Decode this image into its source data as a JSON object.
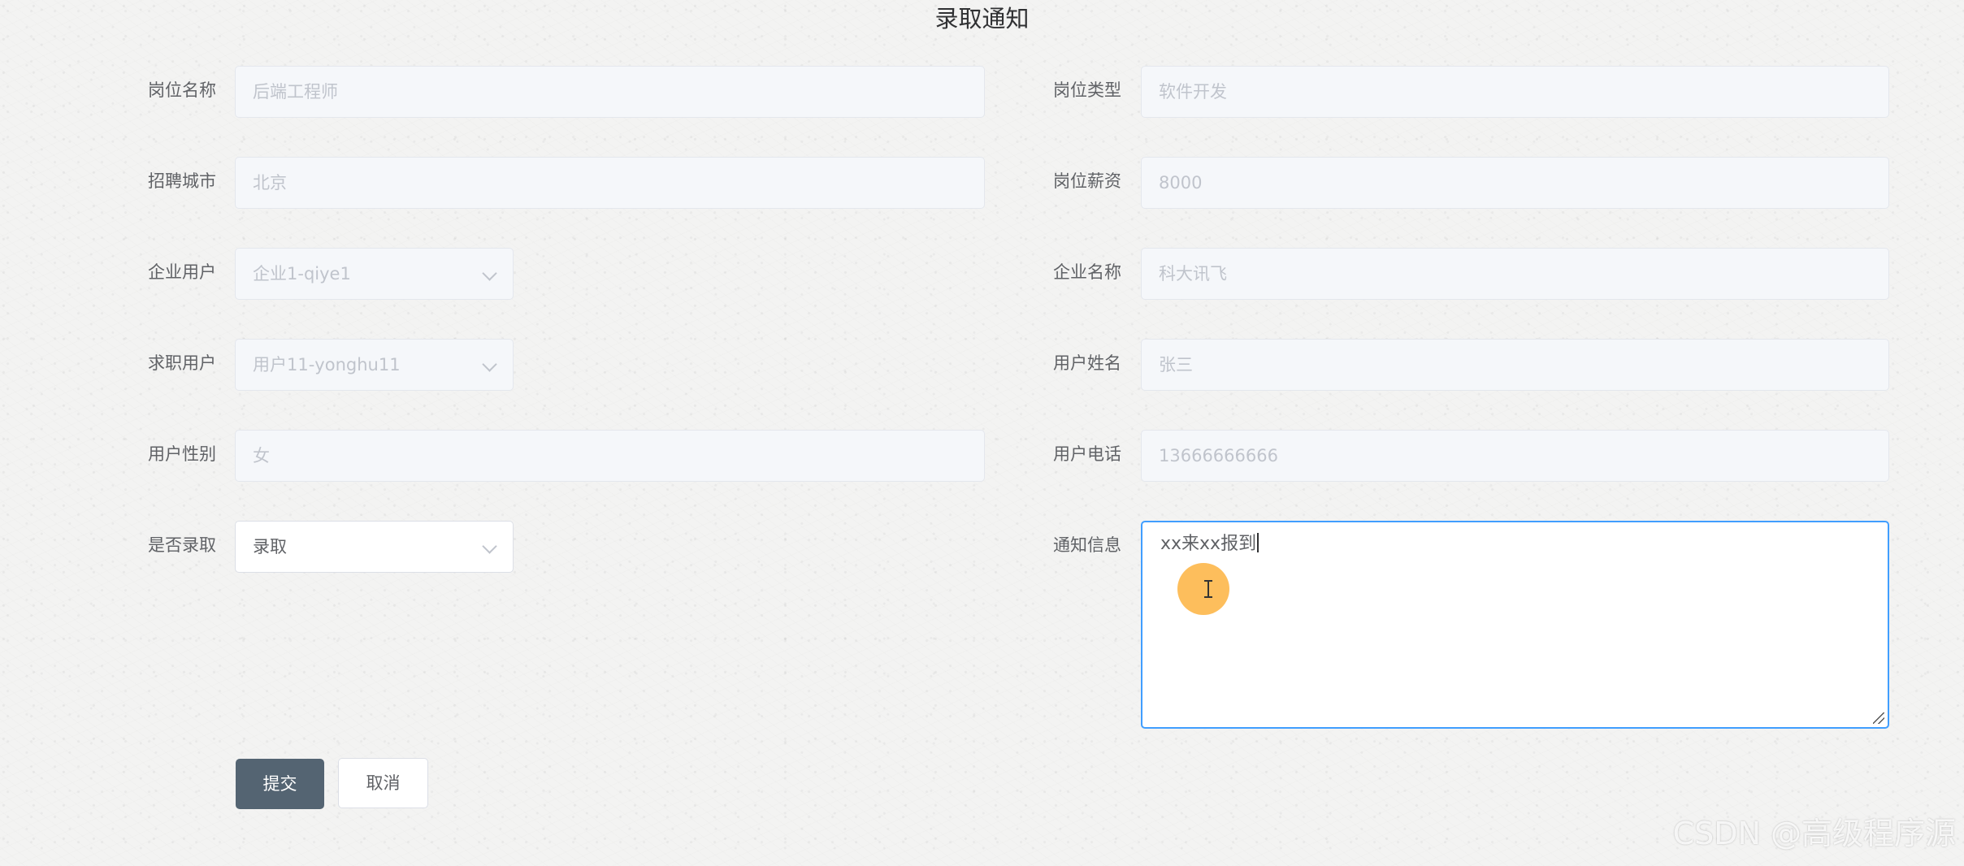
{
  "title": "录取通知",
  "fields": {
    "job_name": {
      "label": "岗位名称",
      "value": "后端工程师"
    },
    "job_type": {
      "label": "岗位类型",
      "value": "软件开发"
    },
    "city": {
      "label": "招聘城市",
      "value": "北京"
    },
    "salary": {
      "label": "岗位薪资",
      "value": "8000"
    },
    "company_user": {
      "label": "企业用户",
      "value": "企业1-qiye1"
    },
    "company_name": {
      "label": "企业名称",
      "value": "科大讯飞"
    },
    "job_seeker": {
      "label": "求职用户",
      "value": "用户11-yonghu11"
    },
    "user_name": {
      "label": "用户姓名",
      "value": "张三"
    },
    "gender": {
      "label": "用户性别",
      "value": "女"
    },
    "phone": {
      "label": "用户电话",
      "value": "13666666666"
    },
    "admitted": {
      "label": "是否录取",
      "value": "录取"
    },
    "notice": {
      "label": "通知信息",
      "value": "xx来xx报到"
    }
  },
  "buttons": {
    "submit": "提交",
    "cancel": "取消"
  },
  "watermark": "CSDN @高级程序源"
}
